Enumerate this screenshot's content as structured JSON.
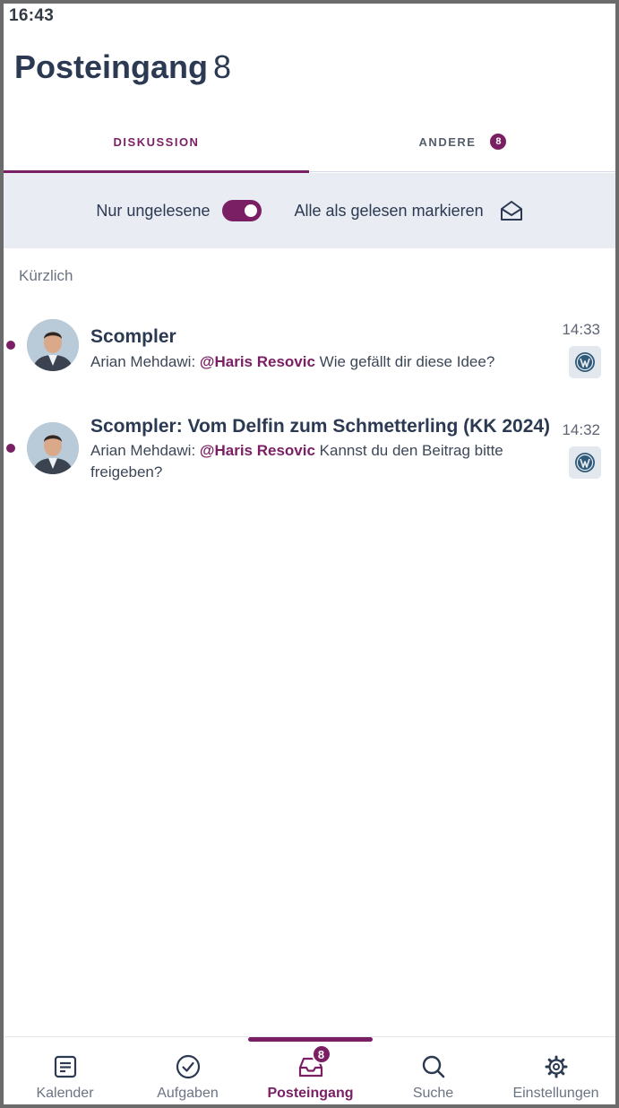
{
  "status_bar": {
    "time": "16:43"
  },
  "header": {
    "title": "Posteingang",
    "count": "8"
  },
  "tabs": [
    {
      "label": "DISKUSSION",
      "active": true
    },
    {
      "label": "ANDERE",
      "badge": "8",
      "active": false
    }
  ],
  "filter": {
    "unread_label": "Nur ungelesene",
    "unread_only": true,
    "mark_all_label": "Alle als gelesen markieren",
    "mark_all_icon": "envelope-open-icon"
  },
  "section": {
    "label": "Kürzlich"
  },
  "items": [
    {
      "title": "Scompler",
      "author": "Arian Mehdawi:",
      "mention": "@Haris Resovic",
      "text": "Wie gefällt dir diese Idee?",
      "time": "14:33",
      "unread": true,
      "source_icon": "wordpress-icon"
    },
    {
      "title": "Scompler: Vom Delfin zum Schmetterling (KK 2024)",
      "author": "Arian Mehdawi:",
      "mention": "@Haris Resovic",
      "text": "Kannst du den Beitrag bitte freigeben?",
      "time": "14:32",
      "unread": true,
      "source_icon": "wordpress-icon"
    }
  ],
  "bottom_nav": [
    {
      "label": "Kalender",
      "icon": "calendar-icon",
      "active": false
    },
    {
      "label": "Aufgaben",
      "icon": "check-circle-icon",
      "active": false
    },
    {
      "label": "Posteingang",
      "icon": "inbox-icon",
      "badge": "8",
      "active": true
    },
    {
      "label": "Suche",
      "icon": "search-icon",
      "active": false
    },
    {
      "label": "Einstellungen",
      "icon": "gear-icon",
      "active": false
    }
  ],
  "colors": {
    "accent": "#7a1f63",
    "text": "#2b3a52",
    "filter_bg": "#e9ecf2"
  }
}
